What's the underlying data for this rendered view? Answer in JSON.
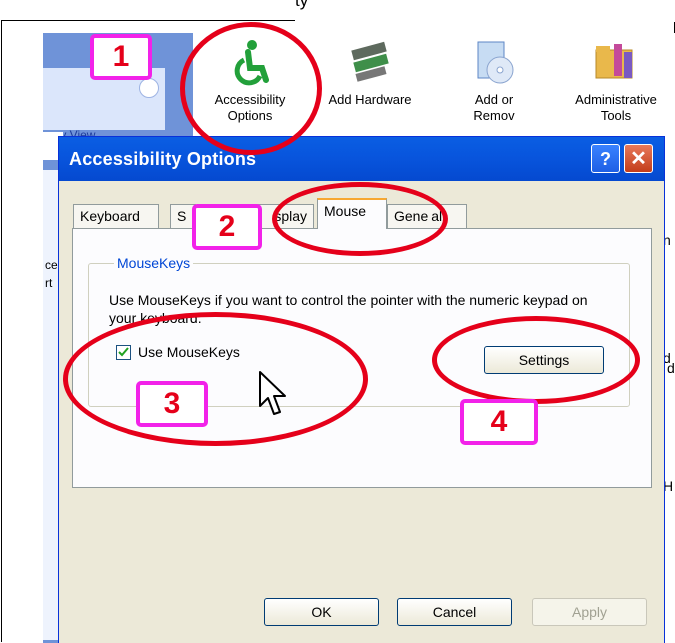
{
  "control_panel": {
    "left_link": "gory View",
    "left_text_1": "ce",
    "left_text_2": "rt",
    "items": [
      {
        "label_line1": "Accessibility",
        "label_line2": "Options",
        "icon": "accessibility-icon"
      },
      {
        "label_line1": "Add Hardware",
        "label_line2": "",
        "icon": "hardware-icon"
      },
      {
        "label_line1": "Add or",
        "label_line2": "Remov",
        "icon": "cd-icon"
      },
      {
        "label_line1": "Administrative",
        "label_line2": "Tools",
        "icon": "folder-tools-icon"
      }
    ],
    "edge_letters": [
      "n",
      "d",
      "d",
      "H"
    ]
  },
  "dialog": {
    "title": "Accessibility Options",
    "help_button": "?",
    "close_button": "✕",
    "tabs": [
      "Keyboard",
      "S",
      "splay",
      "Mouse",
      "Gene",
      "al"
    ],
    "active_tab": "Mouse",
    "group_title": "MouseKeys",
    "description": "Use MouseKeys if you want to control the pointer with the numeric keypad on your keyboard.",
    "checkbox_label": "Use MouseKeys",
    "checkbox_checked": true,
    "settings_button": "Settings",
    "ok_button": "OK",
    "cancel_button": "Cancel",
    "apply_button": "Apply"
  },
  "annotations": {
    "badge_1": "1",
    "badge_2": "2",
    "badge_3": "3",
    "badge_4": "4",
    "ellipse_color": "#e5001a",
    "badge_border_color": "#f222e9"
  },
  "frame_top_text": "ty"
}
